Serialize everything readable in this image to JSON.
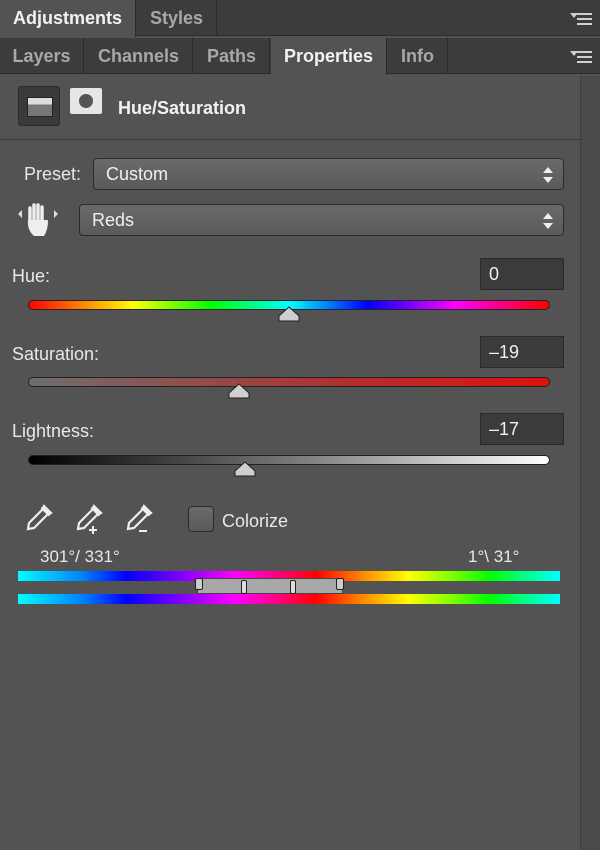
{
  "tabs_top": [
    {
      "label": "Adjustments",
      "active": true
    },
    {
      "label": "Styles",
      "active": false
    }
  ],
  "tabs_panel": [
    {
      "label": "Layers",
      "active": false
    },
    {
      "label": "Channels",
      "active": false
    },
    {
      "label": "Paths",
      "active": false
    },
    {
      "label": "Properties",
      "active": true
    },
    {
      "label": "Info",
      "active": false
    }
  ],
  "header": {
    "title": "Hue/Saturation"
  },
  "preset": {
    "label": "Preset:",
    "value": "Custom"
  },
  "channel": {
    "value": "Reds"
  },
  "hue": {
    "label": "Hue:",
    "value": "0",
    "position": 0.5
  },
  "saturation": {
    "label": "Saturation:",
    "value": "–19",
    "position": 0.405
  },
  "lightness": {
    "label": "Lightness:",
    "value": "–17",
    "position": 0.415
  },
  "colorize": {
    "label": "Colorize",
    "checked": false
  },
  "range": {
    "left": "301°/ 331°",
    "right": "1°\\ 31°"
  },
  "colors": {
    "panel_bg": "#535353",
    "tab_bg": "#3c3c3c",
    "field_bg": "#3b3b3b"
  },
  "icons": [
    "adjustment-layer-icon",
    "layer-mask-icon",
    "targeted-adjustment-hand-icon",
    "eyedropper-icon",
    "eyedropper-add-icon",
    "eyedropper-subtract-icon",
    "panel-menu-icon"
  ]
}
